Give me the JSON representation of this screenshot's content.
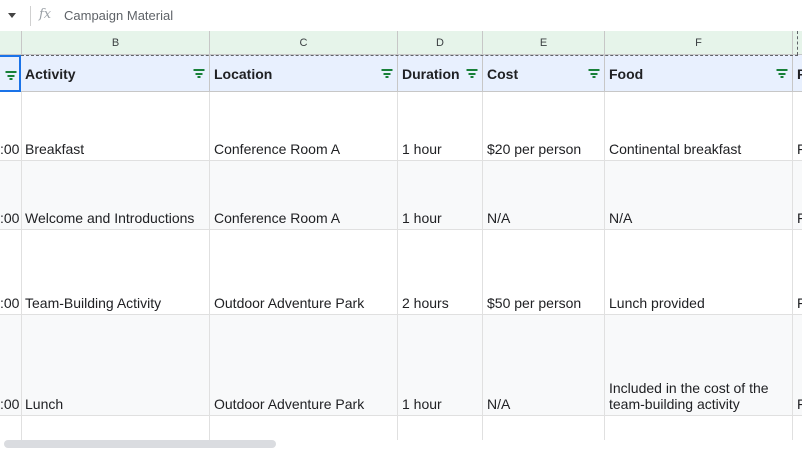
{
  "formula_bar": {
    "fx_label": "fx",
    "value": "Campaign Material"
  },
  "columns": [
    "B",
    "C",
    "D",
    "E",
    "F"
  ],
  "header": {
    "activity": "Activity",
    "location": "Location",
    "duration": "Duration",
    "cost": "Cost",
    "food": "Food",
    "next": "F"
  },
  "rows": [
    {
      "a": ":00",
      "activity": "Breakfast",
      "location": "Conference Room A",
      "duration": "1 hour",
      "cost": "$20 per person",
      "food": "Continental breakfast",
      "g": "F"
    },
    {
      "a": ":00",
      "activity": "Welcome and Introductions",
      "location": "Conference Room A",
      "duration": "1 hour",
      "cost": "N/A",
      "food": "N/A",
      "g": "F"
    },
    {
      "a": ":00",
      "activity": "Team-Building Activity",
      "location": "Outdoor Adventure Park",
      "duration": "2 hours",
      "cost": "$50 per person",
      "food": "Lunch provided",
      "g": "F"
    },
    {
      "a": ":00",
      "activity": "Lunch",
      "location": "Outdoor Adventure Park",
      "duration": "1 hour",
      "cost": "N/A",
      "food": "Included in the cost of the team-building activity",
      "g": "F"
    }
  ],
  "colors": {
    "header_bg": "#e8f0fe",
    "column_header_bg": "#e6f4ea",
    "filter_icon": "#188038",
    "selection": "#1a73e8"
  }
}
